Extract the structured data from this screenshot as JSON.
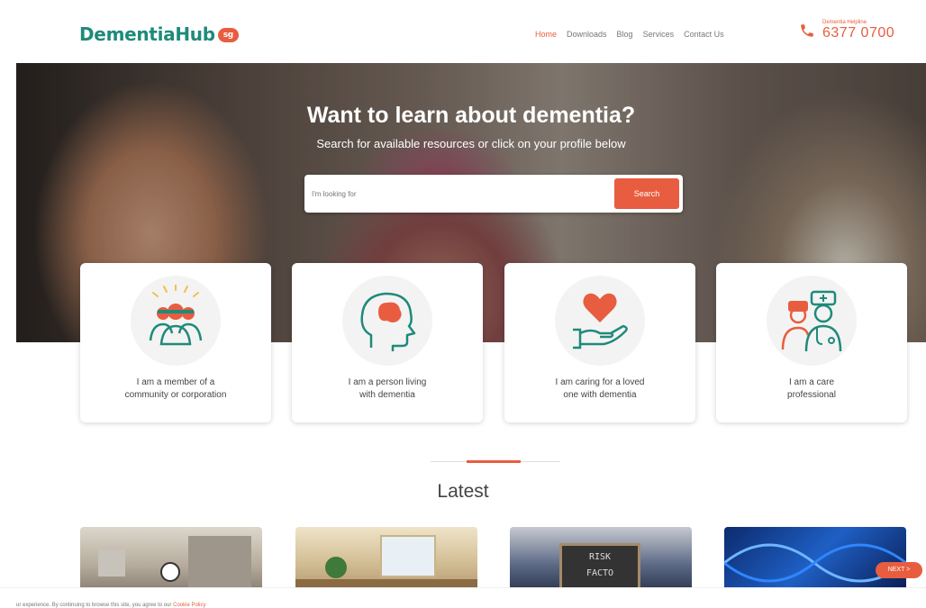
{
  "header": {
    "logo_text": "DementiaHub",
    "logo_badge": "sg",
    "nav": [
      "Home",
      "Downloads",
      "Blog",
      "Services",
      "Contact Us"
    ],
    "hotline_label": "Dementia Helpline",
    "hotline_number": "6377 0700"
  },
  "hero": {
    "title": "Want to learn about dementia?",
    "subtitle": "Search for available resources or click on your profile below",
    "search_placeholder": "I'm looking for",
    "search_button": "Search"
  },
  "profiles": [
    {
      "line1": "I am a member of a",
      "line2": "community or corporation",
      "icon": "community-icon"
    },
    {
      "line1": "I am a person living",
      "line2": "with dementia",
      "icon": "head-brain-icon"
    },
    {
      "line1": "I am caring for a loved",
      "line2": "one with dementia",
      "icon": "heart-hand-icon"
    },
    {
      "line1": "I am a care",
      "line2": "professional",
      "icon": "doctor-nurse-icon"
    }
  ],
  "latest": {
    "title": "Latest",
    "chalkboard_line1": "RISK",
    "chalkboard_line2": "FACTO"
  },
  "cookie": {
    "text": "ur experience. By continuing to browse this site, you agree to our ",
    "link": "Cookie Policy"
  },
  "next_button": "NEXT >",
  "colors": {
    "accent": "#e85d3f",
    "brand": "#1f8a7a"
  }
}
